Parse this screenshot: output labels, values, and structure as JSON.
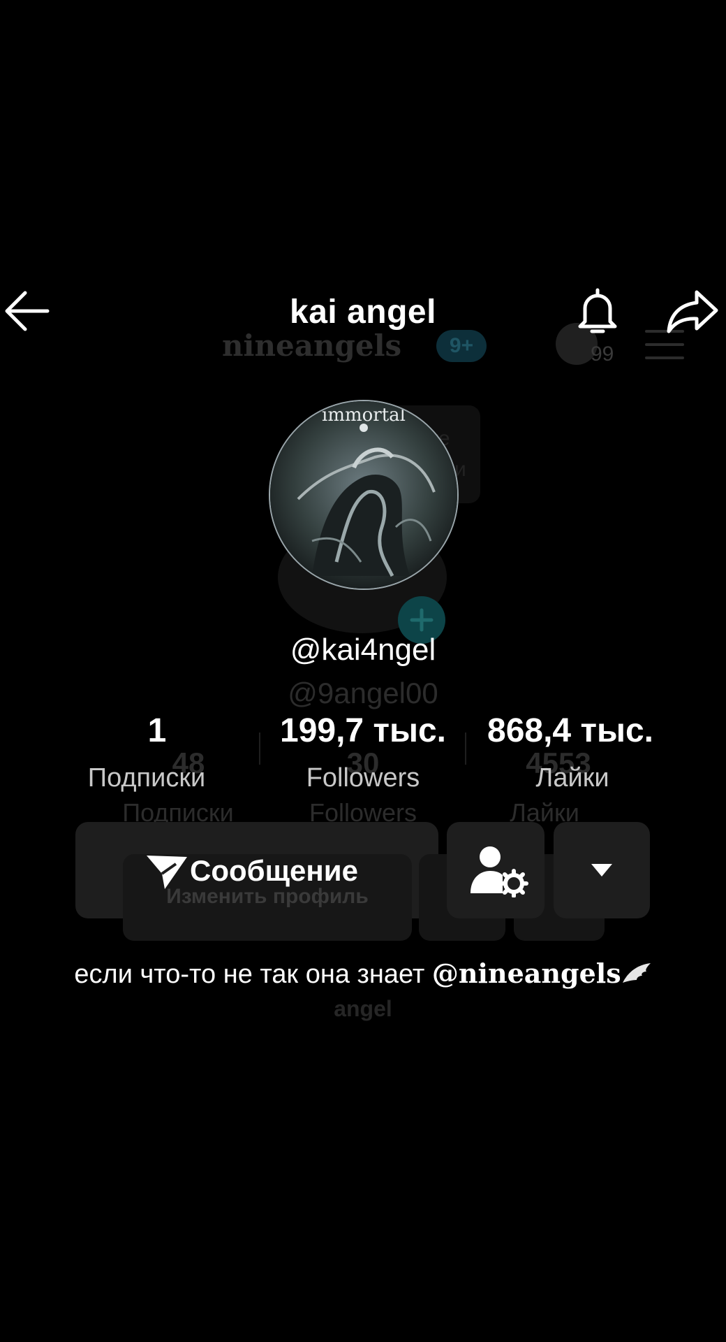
{
  "header": {
    "title": "kai angel",
    "back_icon": "arrow-left-icon",
    "bell_icon": "bell-icon",
    "share_icon": "share-icon"
  },
  "ghost_header": {
    "brand": "nineangels",
    "badge": "9+",
    "count": "99"
  },
  "ghost_box_text": "сте\nмысли",
  "avatar": {
    "caption": "immortal"
  },
  "profile": {
    "handle": "@kai4ngel",
    "ghost_handle": "@9angel00"
  },
  "stats": [
    {
      "value": "1",
      "label": "Подписки"
    },
    {
      "value": "199,7 тыс.",
      "label": "Followers"
    },
    {
      "value": "868,4 тыс.",
      "label": "Лайки"
    }
  ],
  "ghost_stats": [
    {
      "value": "48",
      "label": "Подписки"
    },
    {
      "value": "30",
      "label": "Followers"
    },
    {
      "value": "4553",
      "label": "Лайки"
    }
  ],
  "actions": {
    "message_label": "Сообщение",
    "ghost_edit_label": "Изменить профиль"
  },
  "bio": {
    "text": "если что-то не так она знает ",
    "mention": "@nineangels",
    "ghost_line": "angel"
  },
  "colors": {
    "background": "#000000",
    "button": "#1e1e1e",
    "text": "#ffffff"
  }
}
